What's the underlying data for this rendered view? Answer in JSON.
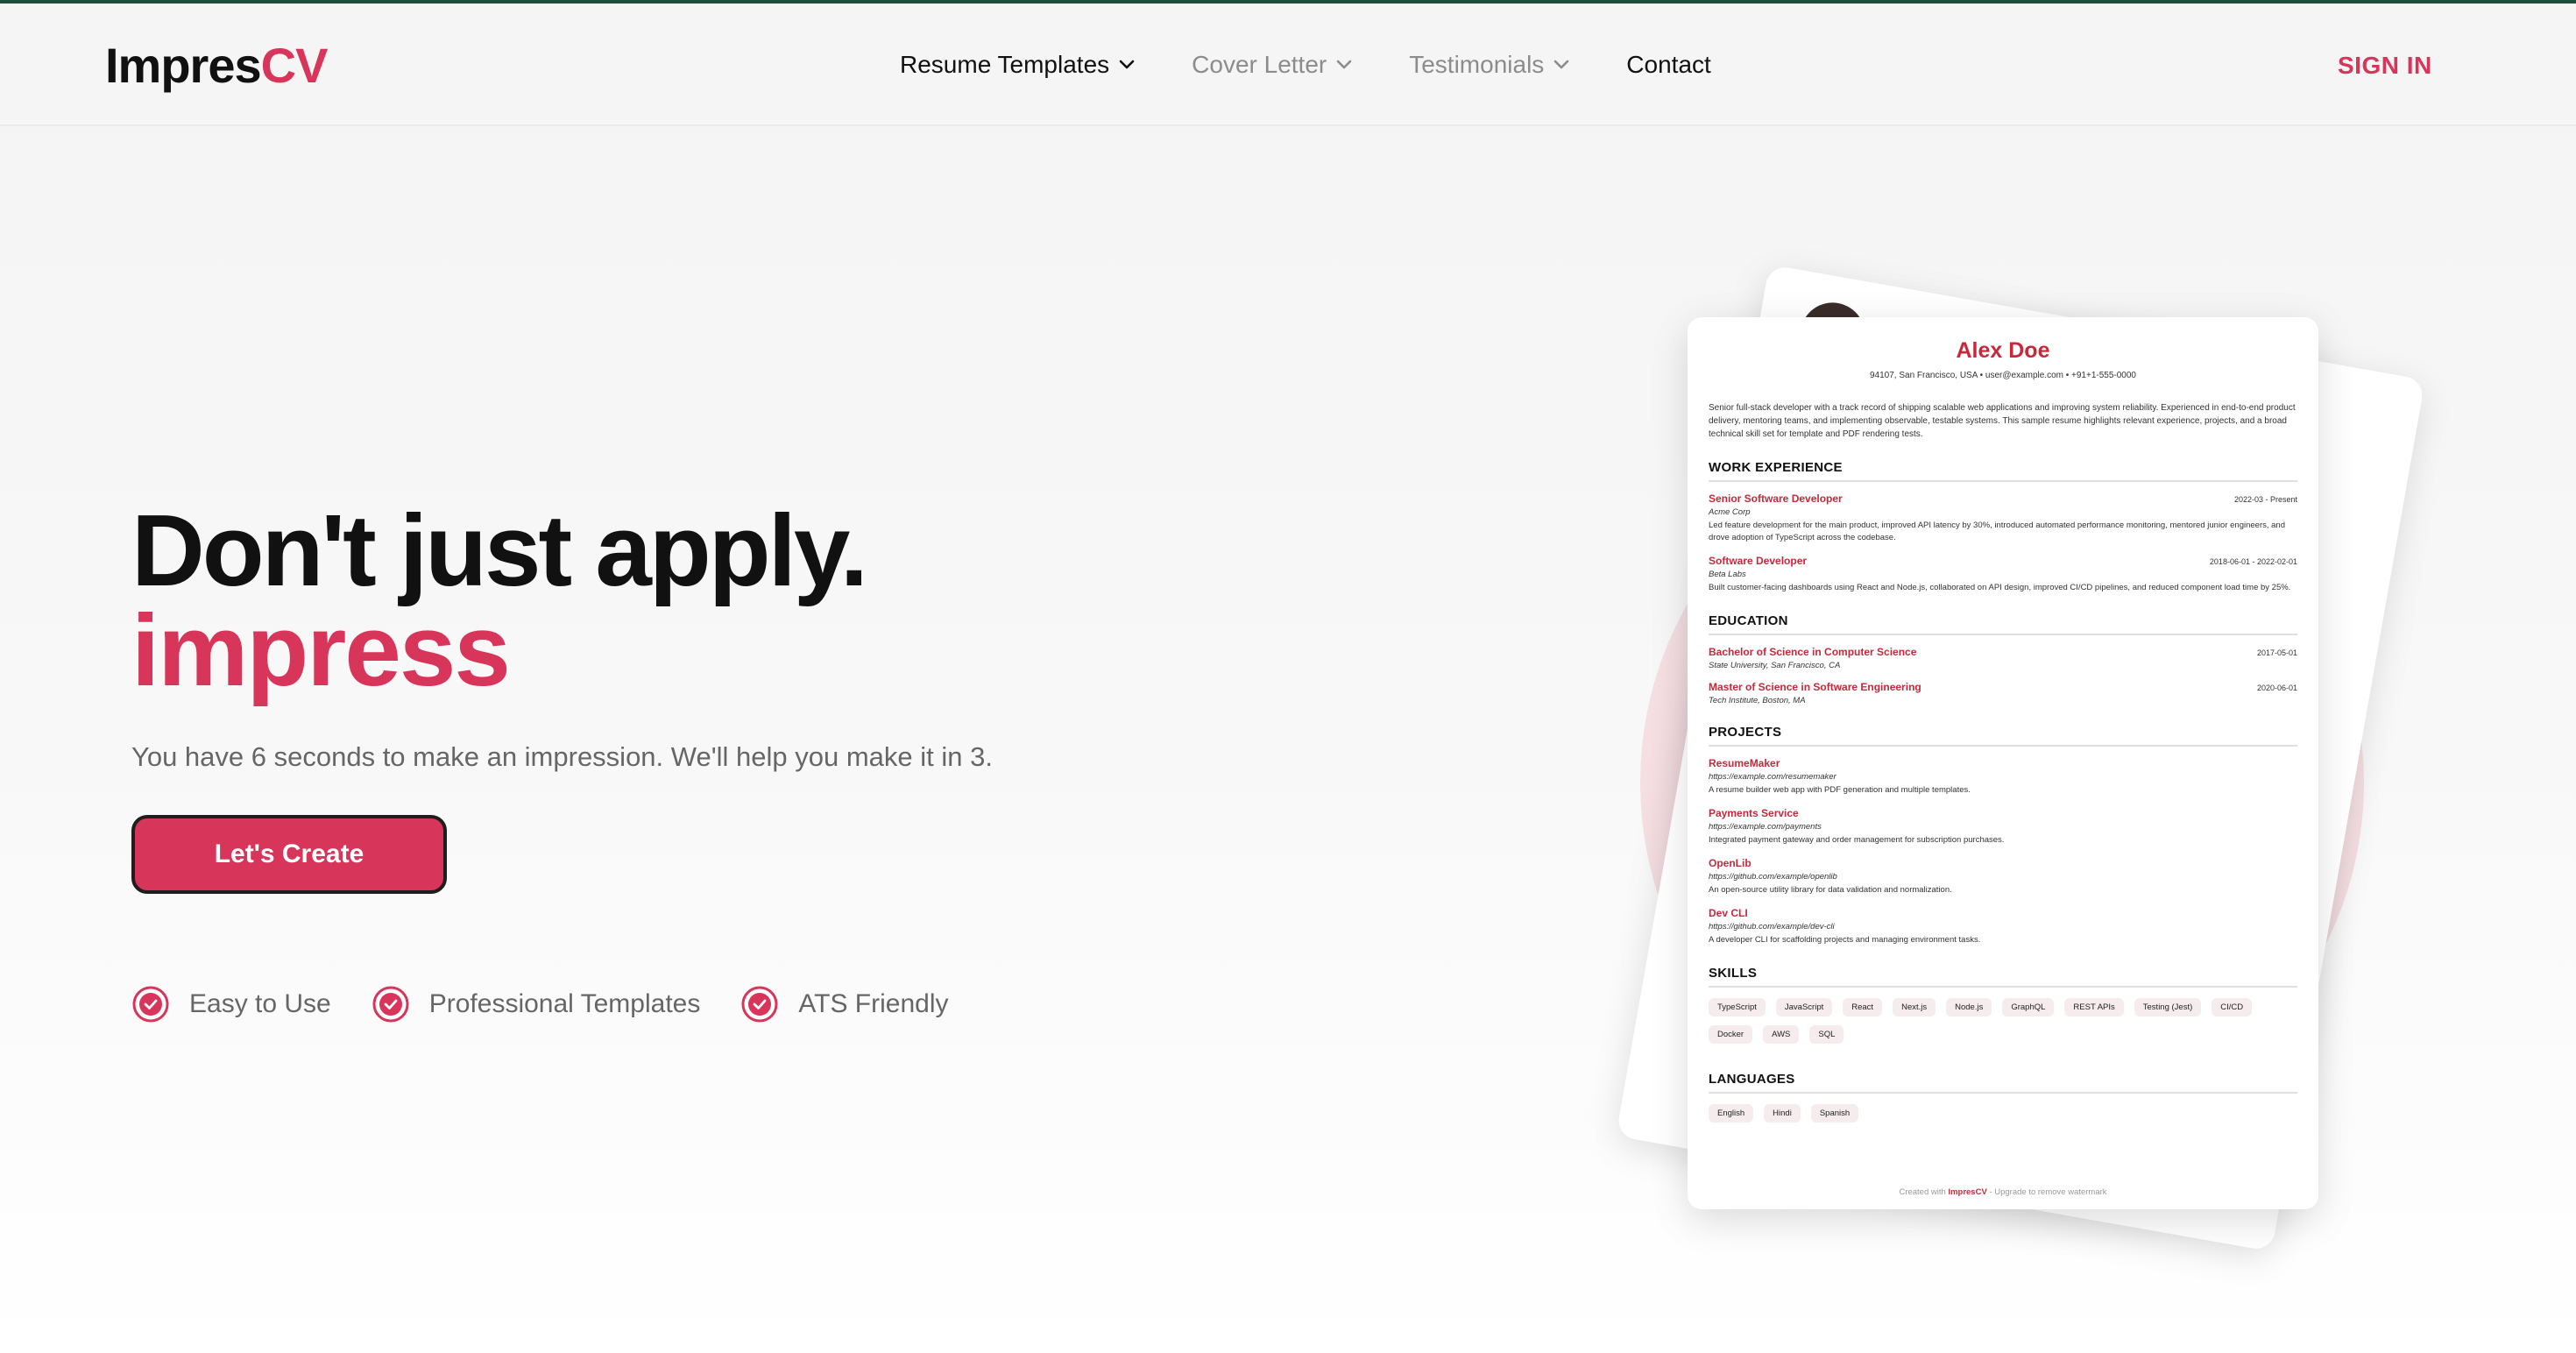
{
  "app": {
    "logo_main": "Impres",
    "logo_accent": "CV"
  },
  "nav": {
    "items": [
      {
        "label": "Resume Templates",
        "has_dropdown": true
      },
      {
        "label": "Cover Letter",
        "has_dropdown": true
      },
      {
        "label": "Testimonials",
        "has_dropdown": true
      },
      {
        "label": "Contact",
        "has_dropdown": false
      }
    ],
    "sign_in": "SIGN IN"
  },
  "hero": {
    "title": "Don't just apply.",
    "accent": "impress",
    "subtitle": "You have 6 seconds to make an impression. We'll help you make it in 3.",
    "cta": "Let's Create",
    "features": [
      "Easy to Use",
      "Professional Templates",
      "ATS Friendly"
    ]
  },
  "resume": {
    "name": "Alex Doe",
    "contact": "94107, San Francisco, USA   •   user@example.com   •   +91+1-555-0000",
    "summary": "Senior full-stack developer with a track record of shipping scalable web applications and improving system reliability. Experienced in end-to-end product delivery, mentoring teams, and implementing observable, testable systems. This sample resume highlights relevant experience, projects, and a broad technical skill set for template and PDF rendering tests.",
    "sections": {
      "work": "WORK EXPERIENCE",
      "education": "EDUCATION",
      "projects": "PROJECTS",
      "skills": "SKILLS",
      "languages": "LANGUAGES"
    },
    "work": [
      {
        "title": "Senior Software Developer",
        "date": "2022-03 - Present",
        "org": "Acme Corp",
        "desc": "Led feature development for the main product, improved API latency by 30%, introduced automated performance monitoring, mentored junior engineers, and drove adoption of TypeScript across the codebase."
      },
      {
        "title": "Software Developer",
        "date": "2018-06-01 - 2022-02-01",
        "org": "Beta Labs",
        "desc": "Built customer-facing dashboards using React and Node.js, collaborated on API design, improved CI/CD pipelines, and reduced component load time by 25%."
      }
    ],
    "education": [
      {
        "title": "Bachelor of Science in Computer Science",
        "date": "2017-05-01",
        "org": "State University, San Francisco, CA"
      },
      {
        "title": "Master of Science in Software Engineering",
        "date": "2020-06-01",
        "org": "Tech Institute, Boston, MA"
      }
    ],
    "projects": [
      {
        "title": "ResumeMaker",
        "url": "https://example.com/resumemaker",
        "desc": "A resume builder web app with PDF generation and multiple templates."
      },
      {
        "title": "Payments Service",
        "url": "https://example.com/payments",
        "desc": "Integrated payment gateway and order management for subscription purchases."
      },
      {
        "title": "OpenLib",
        "url": "https://github.com/example/openlib",
        "desc": "An open-source utility library for data validation and normalization."
      },
      {
        "title": "Dev CLI",
        "url": "https://github.com/example/dev-cli",
        "desc": "A developer CLI for scaffolding projects and managing environment tasks."
      }
    ],
    "skills": [
      "TypeScript",
      "JavaScript",
      "React",
      "Next.js",
      "Node.js",
      "GraphQL",
      "REST APIs",
      "Testing (Jest)",
      "CI/CD",
      "Docker",
      "AWS",
      "SQL"
    ],
    "languages": [
      "English",
      "Hindi",
      "Spanish"
    ],
    "footer_prefix": "Created with",
    "footer_brand": "ImpresCV",
    "footer_suffix": "- Upgrade to remove watermark"
  },
  "colors": {
    "accent": "#d8355a",
    "resume_accent": "#c8283a",
    "topline": "#1f4d3c"
  },
  "icons": {
    "dropdown": "chevron-down-icon",
    "feature": "check-circle-icon"
  }
}
